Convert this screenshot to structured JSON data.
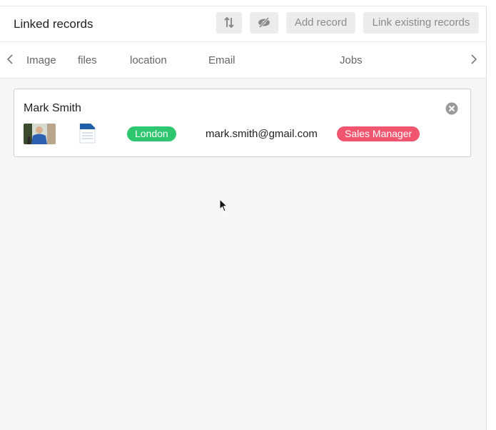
{
  "header": {
    "title": "Linked records",
    "sort_icon": "sort-arrows-icon",
    "hide_icon": "eye-slash-icon",
    "add_record_label": "Add record",
    "link_existing_label": "Link existing records"
  },
  "columns": [
    "Image",
    "files",
    "location",
    "Email",
    "Jobs"
  ],
  "record": {
    "name": "Mark Smith",
    "location": "London",
    "email": "mark.smith@gmail.com",
    "job": "Sales Manager"
  },
  "colors": {
    "location_pill": "#2ec66f",
    "job_pill": "#f2566f",
    "file_icon": "#1f5fa8"
  }
}
